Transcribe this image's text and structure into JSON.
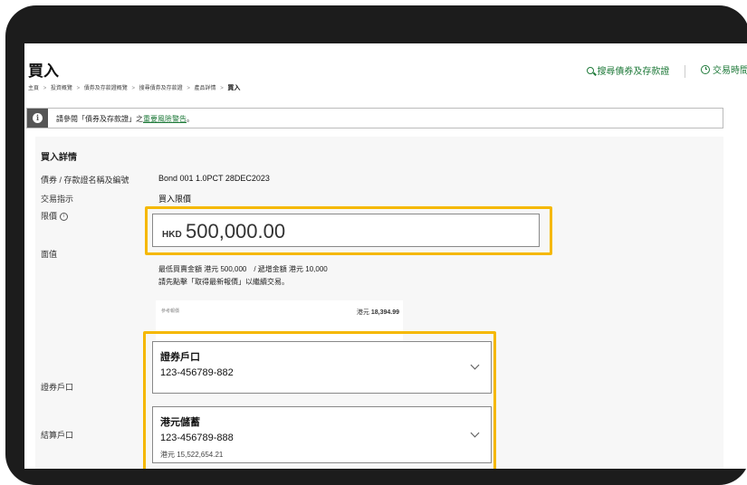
{
  "page": {
    "title": "買入",
    "breadcrumb": [
      "主頁",
      "投資概覽",
      "債券及存款證概覽",
      "搜尋債券及存款證",
      "產品詳情"
    ],
    "breadcrumb_current": "買入",
    "breadcrumb_separator": ">"
  },
  "top_links": {
    "search_label": "搜尋債券及存款證",
    "trading_hours_label": "交易時間"
  },
  "notice": {
    "prefix": "請參閱「債券及存款證」之",
    "link_text": "重要風險警告",
    "suffix": "。"
  },
  "details": {
    "section_title": "買入詳情",
    "product_label": "債券 / 存款證名稱及編號",
    "product_value": "Bond 001 1.0PCT 28DEC2023",
    "instruction_label": "交易指示",
    "instruction_value": "買入限價",
    "limit_label": "限價",
    "face_value_label": "面值",
    "amount_currency": "HKD",
    "amount_value": "500,000.00",
    "hint_line1": "最低買賣金額 港元 500,000　/ 遞增金額 港元 10,000",
    "hint_line2": "請先點擊「取得最新報價」以繼續交易。",
    "quote_label": "參考報價",
    "quote_currency": "港元",
    "quote_amount": "18,394.99",
    "securities_account_label": "證券戶口",
    "settlement_account_label": "結算戶口"
  },
  "securities_dropdown": {
    "title": "證券戶口",
    "value": "123-456789-882"
  },
  "settlement_dropdown": {
    "title": "港元儲蓄",
    "value": "123-456789-888",
    "balance": "港元 15,522,654.21"
  },
  "colors": {
    "highlight": "#f5b800",
    "accent_green": "#1f7a3a",
    "bezel": "#1c1c1c"
  },
  "icons": [
    "search-icon",
    "clock-icon",
    "info-icon",
    "chevron-down-icon"
  ]
}
